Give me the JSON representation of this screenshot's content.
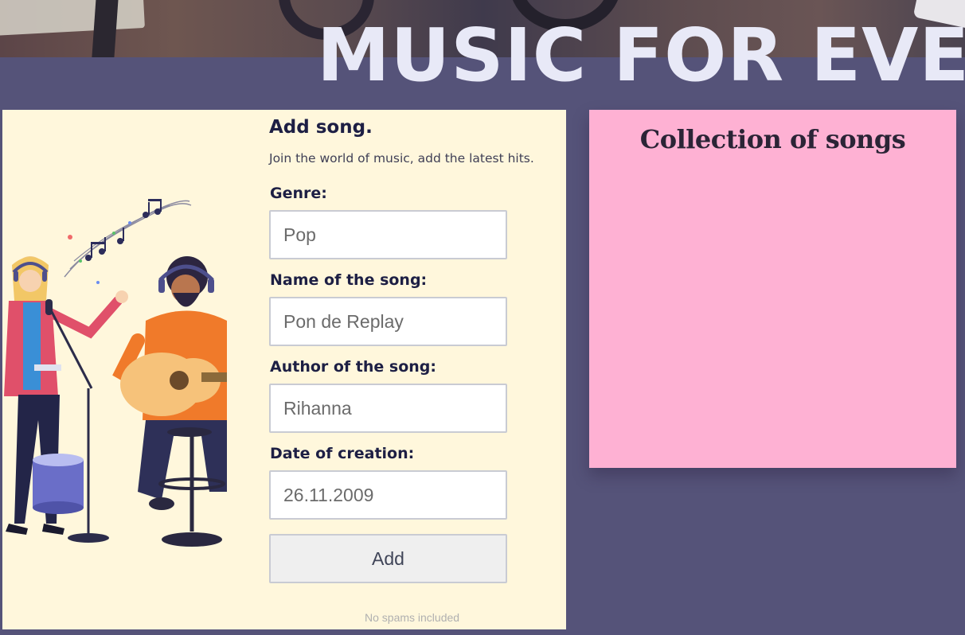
{
  "header": {
    "title": "MUSIC FOR EVE"
  },
  "form": {
    "heading": "Add song.",
    "subtitle": "Join the world of music, add the latest hits.",
    "fields": [
      {
        "label": "Genre:",
        "value": "Pop"
      },
      {
        "label": "Name of the song:",
        "value": "Pon de Replay"
      },
      {
        "label": "Author of the song:",
        "value": "Rihanna"
      },
      {
        "label": "Date of creation:",
        "value": "26.11.2009"
      }
    ],
    "submit_label": "Add",
    "footer_note": "No spams included"
  },
  "collection": {
    "title": "Collection of songs"
  },
  "colors": {
    "background": "#555379",
    "form_card": "#fff7dc",
    "collection_panel": "#feb1d3",
    "title": "#e8e9f7",
    "label": "#1d1f44"
  },
  "icons": [
    "musicians-illustration",
    "music-notes-icon"
  ]
}
